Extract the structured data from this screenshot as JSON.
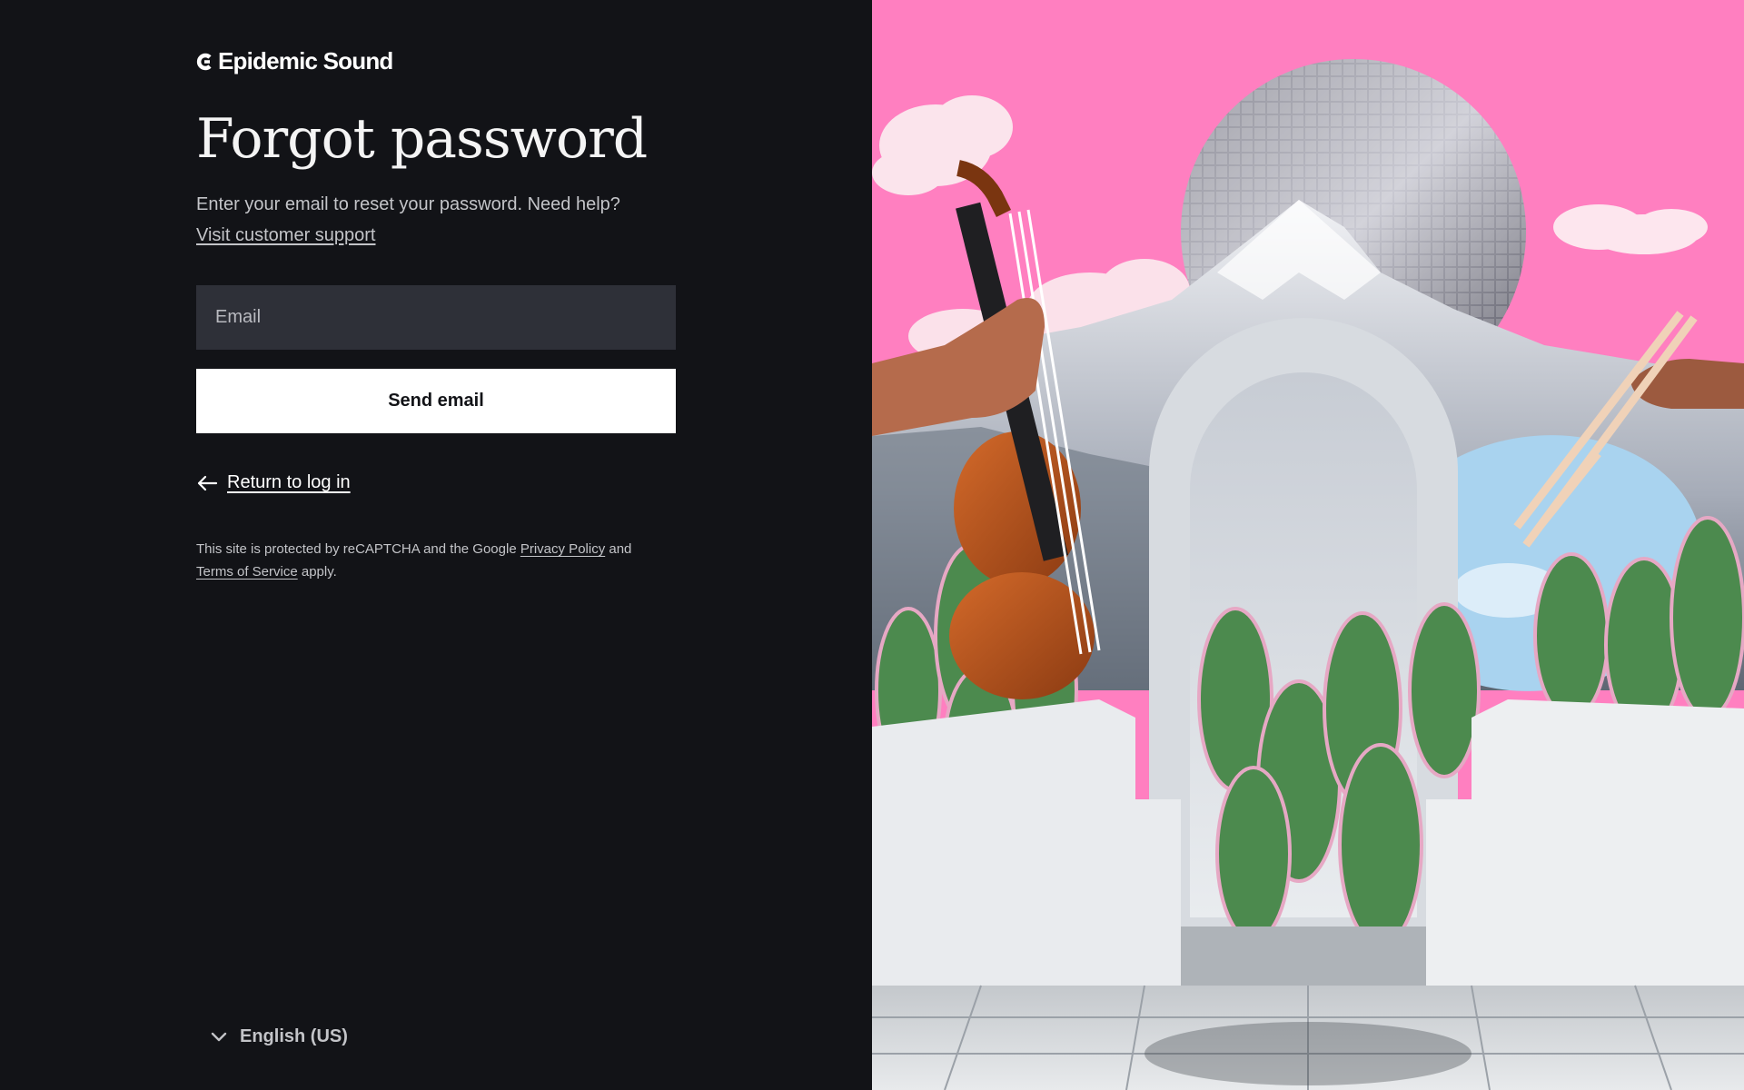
{
  "brand": {
    "name": "Epidemic Sound"
  },
  "form": {
    "title": "Forgot password",
    "subtitle": "Enter your email to reset your password. Need help?",
    "support_link": "Visit customer support",
    "email_placeholder": "Email",
    "send_button": "Send email",
    "return_link": "Return to log in"
  },
  "recaptcha": {
    "prefix": "This site is protected by reCAPTCHA and the Google",
    "privacy_link": "Privacy Policy",
    "middle": "and",
    "terms_link": "Terms of Service",
    "suffix": "apply."
  },
  "language": {
    "selected": "English (US)"
  },
  "icons": {
    "logo": "epidemic-sound-logo-icon",
    "back": "arrow-left-icon",
    "language": "chevron-down-icon"
  },
  "colors": {
    "background": "#121317",
    "input_background": "#2e3038",
    "button_background": "#ffffff",
    "text_primary": "#ffffff",
    "text_secondary": "#c3c4c8",
    "art_sky": "#ff7fc0"
  }
}
